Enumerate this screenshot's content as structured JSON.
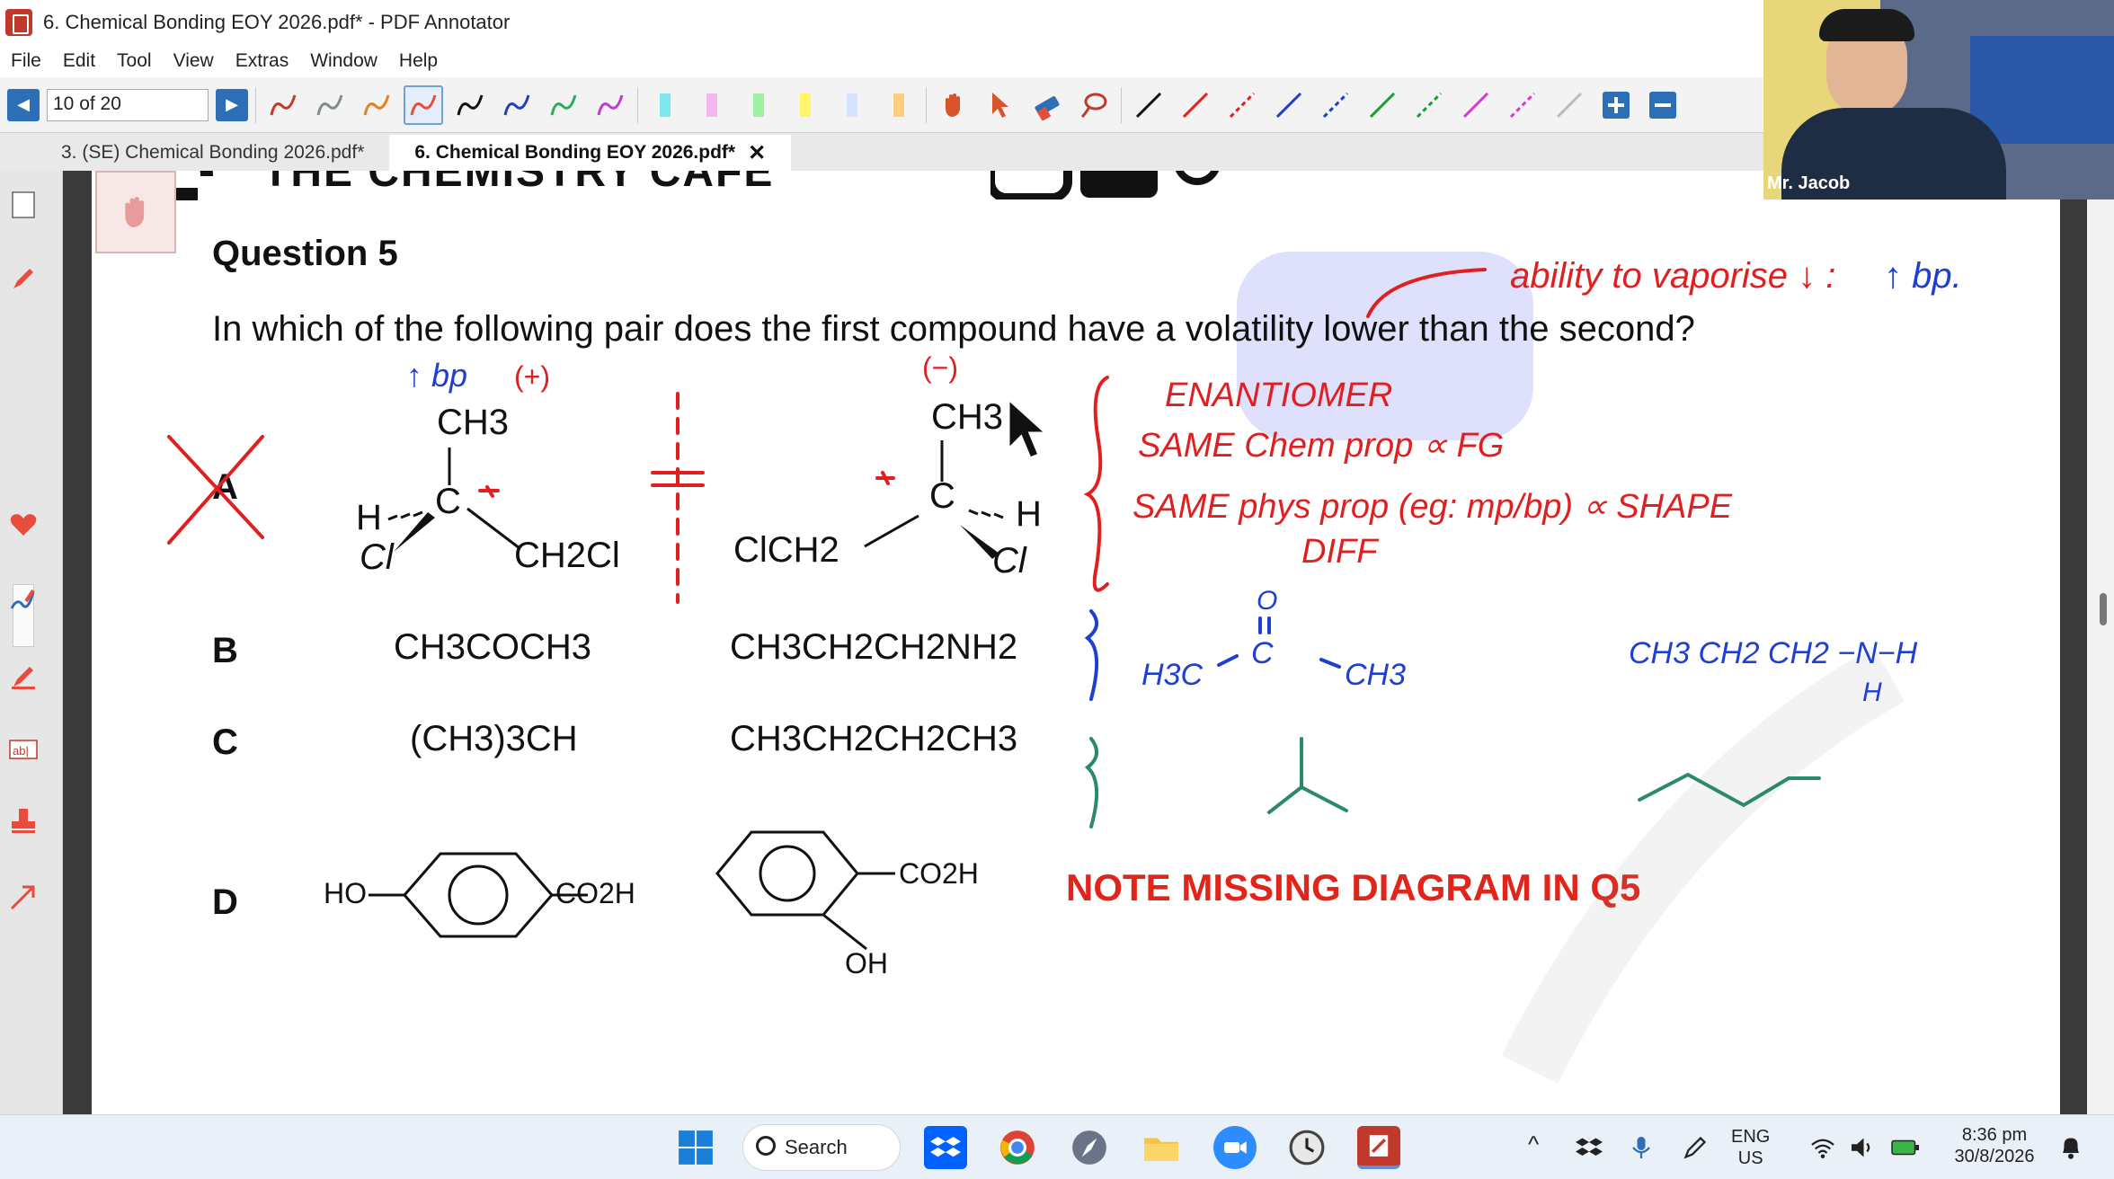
{
  "window": {
    "title": "6. Chemical Bonding EOY 2026.pdf* - PDF Annotator"
  },
  "menu": [
    "File",
    "Edit",
    "Tool",
    "View",
    "Extras",
    "Window",
    "Help"
  ],
  "toolbar": {
    "page_indicator": "10 of 20",
    "pen_colors": [
      "#c0392b",
      "#7f8c8d",
      "#e67e22",
      "#e74c3c",
      "#111111",
      "#1f3fbf",
      "#27ae60",
      "#c13ad0"
    ],
    "highlighter_colors": [
      "#7fe7f0",
      "#f4b6ef",
      "#9ff0a3",
      "#fff36b",
      "#d5e3ff",
      "#ffcc80"
    ],
    "line_colors": [
      "#111111",
      "#e02020",
      "#e02020",
      "#1f3fbf",
      "#1f3fbf",
      "#169e38",
      "#169e38",
      "#d63ad0",
      "#d63ad0",
      "#bbbbbb"
    ]
  },
  "tabs": [
    {
      "label": "3. (SE) Chemical Bonding 2026.pdf*",
      "active": false
    },
    {
      "label": "6. Chemical Bonding EOY 2026.pdf*",
      "active": true
    }
  ],
  "webcam": {
    "name": "Mr. Jacob"
  },
  "document": {
    "banner": "THE CHEMISTRY CAFE",
    "question_title": "Question 5",
    "question_text": "In which of the following pair does the first compound have a volatility lower than the second?",
    "options": [
      {
        "letter": "A",
        "first": {
          "top": "CH3",
          "left": "H",
          "center": "C",
          "bottom_left": "Cl",
          "right": "CH2Cl"
        },
        "second": {
          "top": "CH3",
          "center": "C",
          "right": "H",
          "left": "ClCH2",
          "bottom_right": "Cl"
        }
      },
      {
        "letter": "B",
        "first": "CH3COCH3",
        "second": "CH3CH2CH2NH2"
      },
      {
        "letter": "C",
        "first": "(CH3)3CH",
        "second": "CH3CH2CH2CH3"
      },
      {
        "letter": "D",
        "first": {
          "ho": "HO",
          "acid": "CO2H"
        },
        "second": {
          "acid": "CO2H",
          "oh": "OH"
        }
      }
    ],
    "note": "NOTE MISSING DIAGRAM IN Q5"
  },
  "annotations": {
    "handwritten": {
      "ability": "ability to vaporise ↓ :",
      "up_bp_right": "↑ bp.",
      "up_bp_a": "↑ bp",
      "plus": "(+)",
      "minus": "(−)",
      "enantiomer": "ENANTIOMER",
      "same_chem": "SAME Chem prop ∝ FG",
      "same_phys": "SAME phys prop (eg: mp/bp) ∝ SHAPE",
      "diff": "DIFF",
      "b_lewis_left": "H3C",
      "b_lewis_right": "CH3",
      "b_lewis_c": "C",
      "b_lewis_o": "O",
      "b_amine": "CH3 CH2 CH2 −N−H",
      "b_amine_h": "H"
    },
    "colors": {
      "red": "#e02020",
      "blue": "#1f3fd0",
      "green": "#2b8a6e",
      "highlight": "#d8dafc"
    }
  },
  "taskbar": {
    "search_label": "Search",
    "lang_top": "ENG",
    "lang_bottom": "US",
    "time": "8:36 pm",
    "date": "30/8/2026",
    "icons": [
      "windows-start-icon",
      "dropbox-icon",
      "chrome-icon",
      "safari-icon",
      "file-explorer-icon",
      "zoom-icon",
      "clock-icon",
      "pdf-annotator-icon"
    ]
  }
}
